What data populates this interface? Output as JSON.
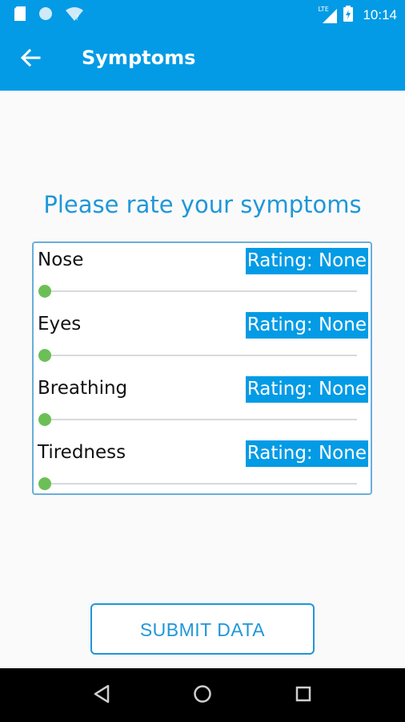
{
  "status_bar": {
    "time": "10:14",
    "network_label": "LTE",
    "icons": [
      "sd-card-icon",
      "notification-dot-icon",
      "wifi-icon",
      "signal-icon",
      "battery-icon"
    ]
  },
  "app_bar": {
    "title": "Symptoms",
    "back_icon": "arrow-left-icon"
  },
  "main": {
    "prompt": "Please rate your symptoms",
    "symptoms": [
      {
        "label": "Nose",
        "rating": "Rating: None",
        "level": 0
      },
      {
        "label": "Eyes",
        "rating": "Rating: None",
        "level": 0
      },
      {
        "label": "Breathing",
        "rating": "Rating: None",
        "level": 0
      },
      {
        "label": "Tiredness",
        "rating": "Rating: None",
        "level": 0
      }
    ],
    "submit_label": "SUBMIT DATA"
  },
  "nav_bar": {
    "icons": [
      "back-triangle-icon",
      "home-circle-icon",
      "recents-square-icon"
    ]
  },
  "colors": {
    "primary": "#039be5",
    "accent_text": "#1f97d8",
    "slider_thumb": "#6cbf57",
    "card_border": "#6aaed8"
  }
}
